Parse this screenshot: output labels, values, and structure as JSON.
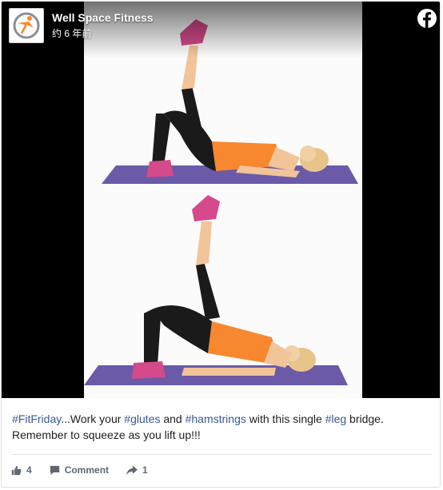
{
  "post": {
    "page_name": "Well Space Fitness",
    "timestamp": "约 6 年前",
    "caption": [
      {
        "type": "tag",
        "text": "#FitFriday"
      },
      {
        "type": "text",
        "text": "...Work your "
      },
      {
        "type": "tag",
        "text": "#glutes"
      },
      {
        "type": "text",
        "text": " and "
      },
      {
        "type": "tag",
        "text": "#hamstrings"
      },
      {
        "type": "text",
        "text": " with this single "
      },
      {
        "type": "tag",
        "text": "#leg"
      },
      {
        "type": "text",
        "text": " bridge. Remember to squeeze as you lift up!!!"
      }
    ]
  },
  "actions": {
    "like_count": "4",
    "comment_label": "Comment",
    "share_count": "1"
  },
  "icons": {
    "facebook": "facebook-logo-icon",
    "like": "thumbs-up-icon",
    "comment": "comment-bubble-icon",
    "share": "share-arrow-icon"
  },
  "colors": {
    "hashtag": "#385898",
    "mat": "#6b5aa8",
    "shirt": "#f7882f",
    "shoe": "#d44a8a"
  }
}
